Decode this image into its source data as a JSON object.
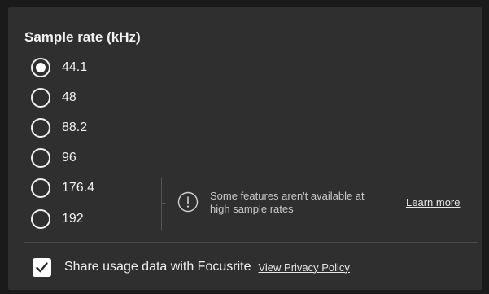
{
  "sample_rate": {
    "title": "Sample rate (kHz)",
    "selected": "44.1",
    "options": [
      {
        "label": "44.1",
        "checked": true
      },
      {
        "label": "48",
        "checked": false
      },
      {
        "label": "88.2",
        "checked": false
      },
      {
        "label": "96",
        "checked": false
      },
      {
        "label": "176.4",
        "checked": false
      },
      {
        "label": "192",
        "checked": false
      }
    ]
  },
  "notice": {
    "icon": "info-icon",
    "line1": "Some features aren't available at",
    "line2": "high sample rates",
    "link_label": "Learn more"
  },
  "usage": {
    "checked": true,
    "label": "Share usage data with Focusrite",
    "link_label": "View Privacy Policy"
  },
  "colors": {
    "panel_bg": "#2f2f2f",
    "outer_bg": "#1a1a1a",
    "text": "#f0f0f0",
    "muted_text": "#c8c8c8"
  }
}
